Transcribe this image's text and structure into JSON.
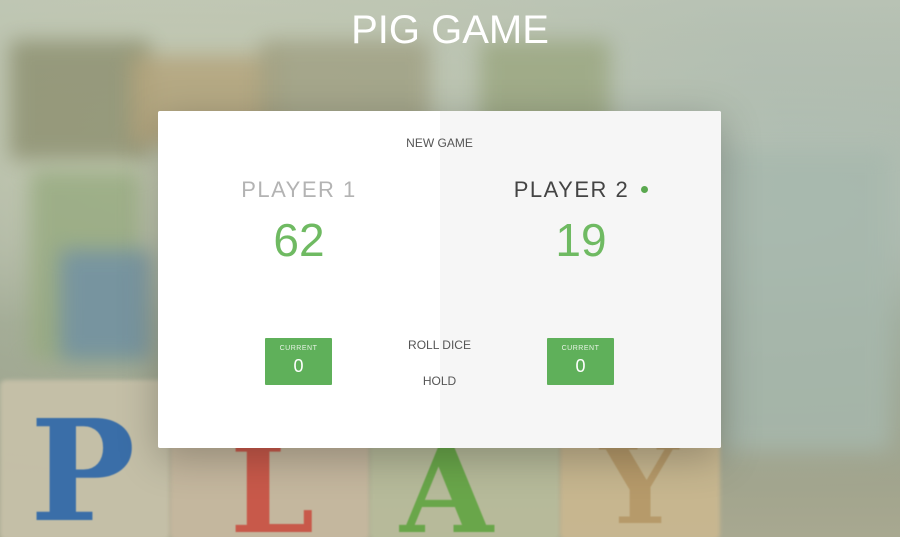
{
  "app": {
    "title": "PIG GAME"
  },
  "controls": {
    "new_game": "NEW GAME",
    "roll_dice": "ROLL DICE",
    "hold": "HOLD"
  },
  "players": [
    {
      "name": "PLAYER 1",
      "score": "62",
      "current_label": "CURRENT",
      "current_value": "0",
      "active": false
    },
    {
      "name": "PLAYER 2",
      "score": "19",
      "current_label": "CURRENT",
      "current_value": "0",
      "active": true
    }
  ],
  "colors": {
    "accent": "#5fb05a",
    "score_text": "#6fba62",
    "active_dot": "#5aa84f"
  }
}
